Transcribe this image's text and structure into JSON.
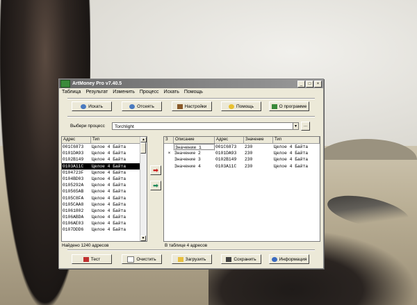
{
  "window": {
    "title": "ArtMoney Pro v7.40.5",
    "min": "_",
    "max": "□",
    "close": "×"
  },
  "menu": [
    "Таблица",
    "Результат",
    "Изменить",
    "Процесс",
    "Искать",
    "Помощь"
  ],
  "toolbar": {
    "search": "Искать",
    "filter": "Отсеять",
    "settings": "Настройки",
    "help": "Помощь",
    "about": "О программе"
  },
  "process": {
    "label": "Выбери процесс",
    "value": "Torchlight",
    "more": "..."
  },
  "left_table": {
    "columns": [
      "Адрес",
      "Тип"
    ],
    "rows": [
      [
        "001C6873",
        "Целое 4 Байта"
      ],
      [
        "0101DA93",
        "Целое 4 Байта"
      ],
      [
        "0102B149",
        "Целое 4 Байта"
      ],
      [
        "0103A11C",
        "Целое 4 Байта"
      ],
      [
        "0104723F",
        "Целое 4 Байта"
      ],
      [
        "0104BD03",
        "Целое 4 Байта"
      ],
      [
        "0105292A",
        "Целое 4 Байта"
      ],
      [
        "010565AB",
        "Целое 4 Байта"
      ],
      [
        "0105C8FA",
        "Целое 4 Байта"
      ],
      [
        "0105CAA8",
        "Целое 4 Байта"
      ],
      [
        "01061802",
        "Целое 4 Байта"
      ],
      [
        "0106ABDA",
        "Целое 4 Байта"
      ],
      [
        "0106AE03",
        "Целое 4 Байта"
      ],
      [
        "0107DDD6",
        "Целое 4 Байта"
      ]
    ],
    "selected_index": 3,
    "status": "Найдено 1240 адресов"
  },
  "right_table": {
    "columns": [
      "З",
      "Описание",
      "Адрес",
      "Значение",
      "Тип"
    ],
    "rows": [
      [
        "",
        "Значение 1",
        "001C6873",
        "230",
        "Целое 4 Байта"
      ],
      [
        "×",
        "Значение 2",
        "0101DA93",
        "230",
        "Целое 4 Байта"
      ],
      [
        "",
        "Значение 3",
        "0102B149",
        "230",
        "Целое 4 Байта"
      ],
      [
        "",
        "Значение 4",
        "0103A11C",
        "230",
        "Целое 4 Байта"
      ]
    ],
    "status": "В таблице 4 адресов"
  },
  "bottom": {
    "test": "Тест",
    "clear": "Очистить",
    "load": "Загрузить",
    "save": "Сохранить",
    "info": "Информация"
  },
  "colors": {
    "add_arrow": "#cc1f1f",
    "remove_arrow": "#1f8a5a",
    "selection": "#000000"
  }
}
